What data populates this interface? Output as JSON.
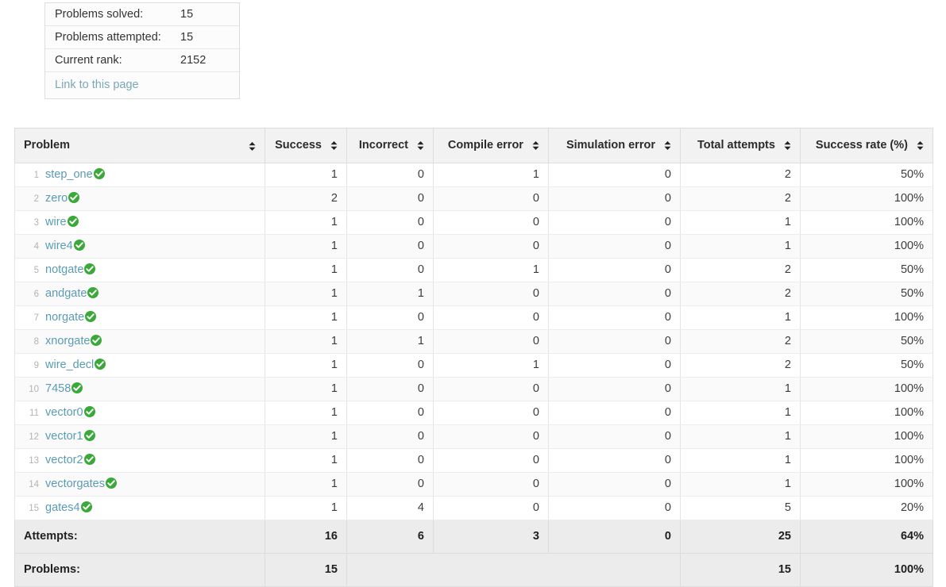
{
  "summary_box": {
    "rows": [
      {
        "label": "Problems solved:",
        "value": "15"
      },
      {
        "label": "Problems attempted:",
        "value": "15"
      },
      {
        "label": "Current rank:",
        "value": "2152"
      }
    ],
    "link_label": "Link to this page"
  },
  "table": {
    "columns": [
      {
        "label": "Problem",
        "align": "left"
      },
      {
        "label": "Success",
        "align": "right"
      },
      {
        "label": "Incorrect",
        "align": "right"
      },
      {
        "label": "Compile error",
        "align": "right"
      },
      {
        "label": "Simulation error",
        "align": "right"
      },
      {
        "label": "Total attempts",
        "align": "right"
      },
      {
        "label": "Success rate (%)",
        "align": "right"
      }
    ],
    "sort_icon": "sort-updown-icon",
    "solved_icon": "check-circle-icon",
    "rows": [
      {
        "index": "1",
        "name": "step_one",
        "solved": true,
        "success": "1",
        "incorrect": "0",
        "compile_error": "1",
        "simulation_error": "0",
        "total_attempts": "2",
        "success_rate": "50%"
      },
      {
        "index": "2",
        "name": "zero",
        "solved": true,
        "success": "2",
        "incorrect": "0",
        "compile_error": "0",
        "simulation_error": "0",
        "total_attempts": "2",
        "success_rate": "100%"
      },
      {
        "index": "3",
        "name": "wire",
        "solved": true,
        "success": "1",
        "incorrect": "0",
        "compile_error": "0",
        "simulation_error": "0",
        "total_attempts": "1",
        "success_rate": "100%"
      },
      {
        "index": "4",
        "name": "wire4",
        "solved": true,
        "success": "1",
        "incorrect": "0",
        "compile_error": "0",
        "simulation_error": "0",
        "total_attempts": "1",
        "success_rate": "100%"
      },
      {
        "index": "5",
        "name": "notgate",
        "solved": true,
        "success": "1",
        "incorrect": "0",
        "compile_error": "1",
        "simulation_error": "0",
        "total_attempts": "2",
        "success_rate": "50%"
      },
      {
        "index": "6",
        "name": "andgate",
        "solved": true,
        "success": "1",
        "incorrect": "1",
        "compile_error": "0",
        "simulation_error": "0",
        "total_attempts": "2",
        "success_rate": "50%"
      },
      {
        "index": "7",
        "name": "norgate",
        "solved": true,
        "success": "1",
        "incorrect": "0",
        "compile_error": "0",
        "simulation_error": "0",
        "total_attempts": "1",
        "success_rate": "100%"
      },
      {
        "index": "8",
        "name": "xnorgate",
        "solved": true,
        "success": "1",
        "incorrect": "1",
        "compile_error": "0",
        "simulation_error": "0",
        "total_attempts": "2",
        "success_rate": "50%"
      },
      {
        "index": "9",
        "name": "wire_decl",
        "solved": true,
        "success": "1",
        "incorrect": "0",
        "compile_error": "1",
        "simulation_error": "0",
        "total_attempts": "2",
        "success_rate": "50%"
      },
      {
        "index": "10",
        "name": "7458",
        "solved": true,
        "success": "1",
        "incorrect": "0",
        "compile_error": "0",
        "simulation_error": "0",
        "total_attempts": "1",
        "success_rate": "100%"
      },
      {
        "index": "11",
        "name": "vector0",
        "solved": true,
        "success": "1",
        "incorrect": "0",
        "compile_error": "0",
        "simulation_error": "0",
        "total_attempts": "1",
        "success_rate": "100%"
      },
      {
        "index": "12",
        "name": "vector1",
        "solved": true,
        "success": "1",
        "incorrect": "0",
        "compile_error": "0",
        "simulation_error": "0",
        "total_attempts": "1",
        "success_rate": "100%"
      },
      {
        "index": "13",
        "name": "vector2",
        "solved": true,
        "success": "1",
        "incorrect": "0",
        "compile_error": "0",
        "simulation_error": "0",
        "total_attempts": "1",
        "success_rate": "100%"
      },
      {
        "index": "14",
        "name": "vectorgates",
        "solved": true,
        "success": "1",
        "incorrect": "0",
        "compile_error": "0",
        "simulation_error": "0",
        "total_attempts": "1",
        "success_rate": "100%"
      },
      {
        "index": "15",
        "name": "gates4",
        "solved": true,
        "success": "1",
        "incorrect": "4",
        "compile_error": "0",
        "simulation_error": "0",
        "total_attempts": "5",
        "success_rate": "20%"
      }
    ],
    "totals": {
      "attempts": {
        "label": "Attempts:",
        "success": "16",
        "incorrect": "6",
        "compile_error": "3",
        "simulation_error": "0",
        "total_attempts": "25",
        "success_rate": "64%"
      },
      "problems": {
        "label": "Problems:",
        "success": "15",
        "merged_blank": "",
        "total_attempts": "15",
        "success_rate": "100%"
      }
    }
  },
  "colors": {
    "link": "#5b9cb4",
    "solved_green": "#3aa93a",
    "header_bg": "#f2f2f2",
    "summary_bg": "#ececec",
    "stripe_bg": "#fafafa"
  }
}
